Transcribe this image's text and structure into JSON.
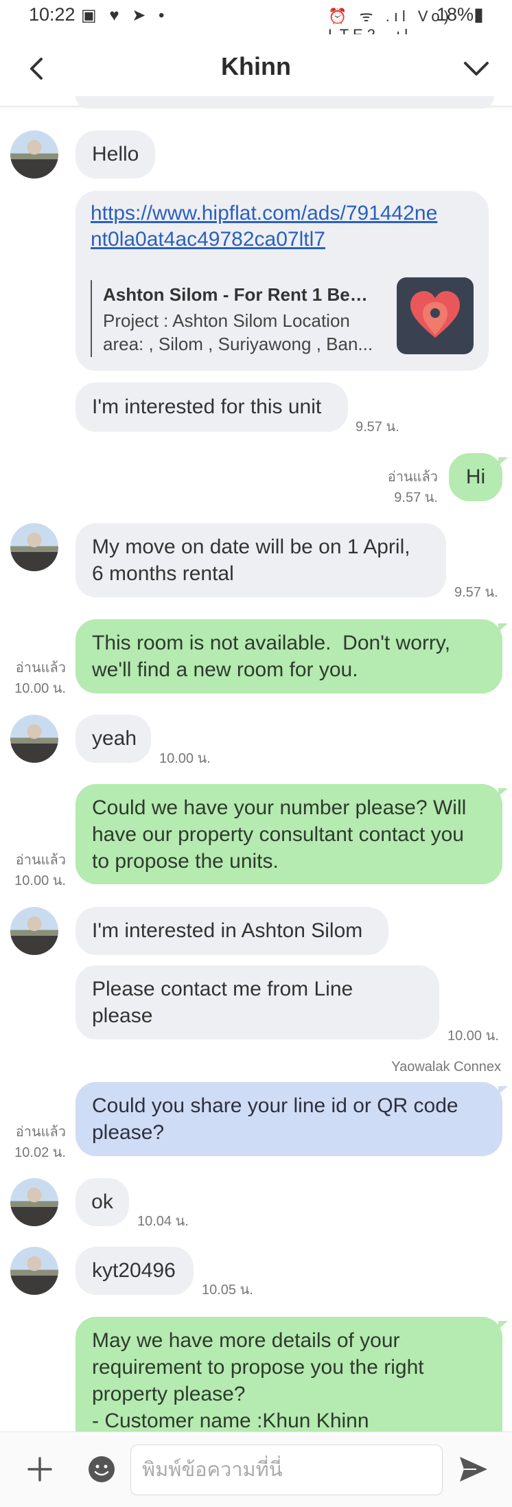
{
  "status_bar": {
    "time": "10:22",
    "left_icons": "▣ ♥ ➤ •",
    "right_icons": "⏰ ᯤ .ıl Vo) LTE2 .ıl",
    "battery": "18%▮"
  },
  "header": {
    "title": "Khinn",
    "back_icon": "back-arrow-icon",
    "menu_icon": "chevron-down-icon"
  },
  "messages": {
    "m1": {
      "text": "Hello"
    },
    "m2": {
      "link": "https://www.hipflat.com/ads/791442nent0la0at4ac49782ca07ltl7",
      "link_line1": "https://www.hipflat.com/ads/791442ne",
      "link_line2": "nt0la0at4ac49782ca07ltl7",
      "card_title": "Ashton Silom - For Rent 1 Bed ...",
      "card_desc_line1": "Project : Ashton Silom Location",
      "card_desc_line2": "area: , Silom , Suriyawong , Ban...",
      "card_logo": "hipflat-heart-pin-icon"
    },
    "m3": {
      "text": "I'm interested for this unit",
      "time": "9.57 น."
    },
    "m4": {
      "text": "Hi",
      "read": "อ่านแล้ว",
      "time": "9.57 น."
    },
    "m5": {
      "line1": "My move on date will be on 1 April,",
      "line2": "6 months rental",
      "time": "9.57 น."
    },
    "m6": {
      "line1": "This room is not available.  Don't worry,",
      "line2": "we'll find a new room for you.",
      "read": "อ่านแล้ว",
      "time": "10.00 น."
    },
    "m7": {
      "text": "yeah",
      "time": "10.00 น."
    },
    "m8": {
      "line1": "Could we have your number please? Will",
      "line2": "have our property consultant contact you",
      "line3": "to propose the units.",
      "read": "อ่านแล้ว",
      "time": "10.00 น."
    },
    "m9": {
      "text": "I'm interested in Ashton Silom"
    },
    "m10": {
      "line1": "Please contact me from Line",
      "line2": "please",
      "time": "10.00 น."
    },
    "m11": {
      "sender": "Yaowalak Connex",
      "line1": "Could you share your line id or QR code",
      "line2": "please?",
      "read": "อ่านแล้ว",
      "time": "10.02 น."
    },
    "m12": {
      "text": "ok",
      "time": "10.04 น."
    },
    "m13": {
      "text": "kyt20496",
      "time": "10.05 น."
    },
    "m14": {
      "line1": "May we have more details of your",
      "line2": "requirement to propose you the right",
      "line3": "property please?",
      "line4": "- Customer name :Khun Khinn"
    }
  },
  "composer": {
    "placeholder": "พิมพ์ข้อความที่นี่",
    "add_icon": "plus-icon",
    "emoji_icon": "emoji-icon",
    "send_icon": "send-icon"
  },
  "colors": {
    "incoming_bubble": "#eeeff2",
    "outgoing_bubble": "#b5eab0",
    "staff_bubble": "#cfdcf5",
    "link": "#2a5fc0"
  }
}
